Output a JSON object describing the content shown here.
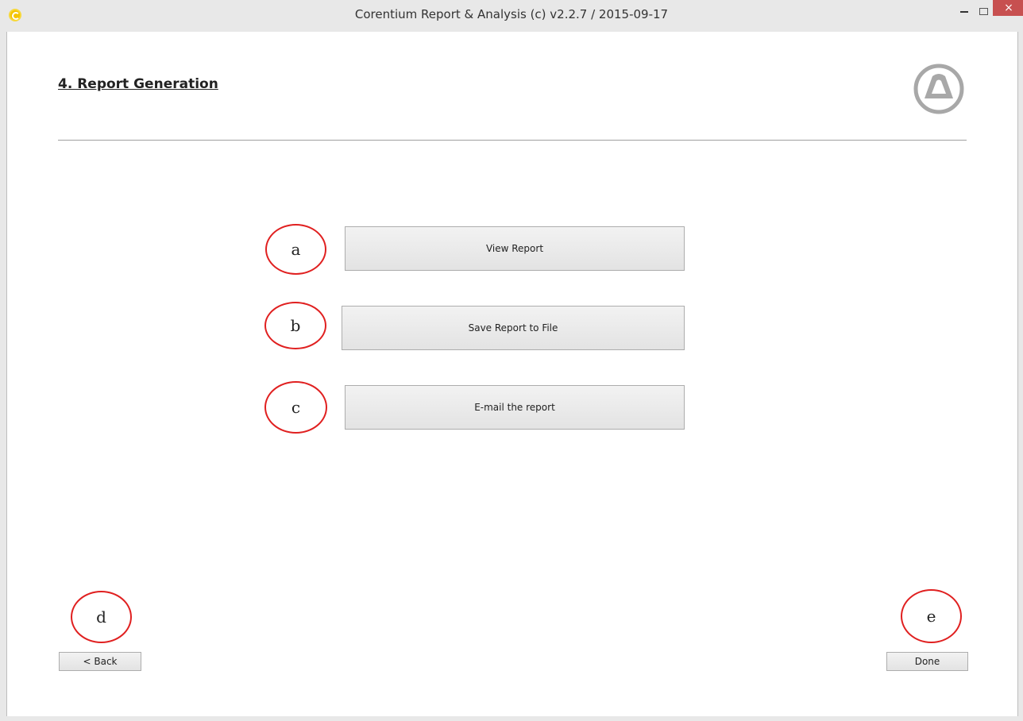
{
  "window": {
    "title": "Corentium Report & Analysis  (c) v2.2.7 / 2015-09-17",
    "close_glyph": "×"
  },
  "page": {
    "title": "4. Report Generation"
  },
  "actions": {
    "view_report": "View Report",
    "save_report": "Save Report to File",
    "email_report": "E-mail the report"
  },
  "nav": {
    "back": "< Back",
    "done": "Done"
  },
  "annotations": {
    "a": "a",
    "b": "b",
    "c": "c",
    "d": "d",
    "e": "e"
  },
  "colors": {
    "annotation_circle": "#e02020",
    "app_icon": "#f4c400",
    "close_button": "#c75050"
  },
  "icons": {
    "app": "corentium-app-icon",
    "logo": "corentium-logo-icon"
  }
}
